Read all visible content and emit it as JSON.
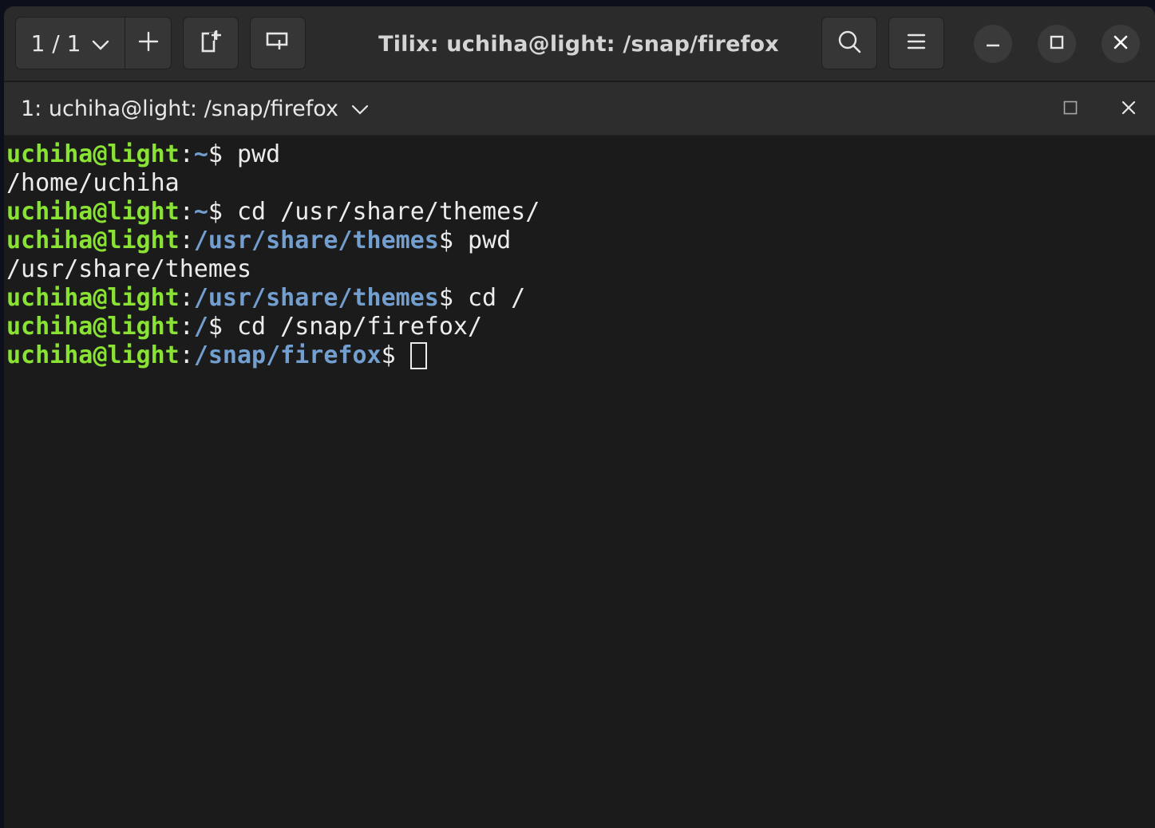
{
  "app": {
    "window_title": "Tilix: uchiha@light: /snap/firefox"
  },
  "headerbar": {
    "session_label": "1 / 1",
    "icons": {
      "session_dropdown": "chevron-down-icon",
      "add_session": "plus-icon",
      "add_terminal_right": "split-right-icon",
      "add_terminal_down": "split-down-icon",
      "search": "search-icon",
      "menu": "hamburger-icon",
      "minimize": "minimize-icon",
      "maximize": "maximize-icon",
      "close": "close-icon"
    }
  },
  "terminal_bar": {
    "title": "1: uchiha@light: /snap/firefox"
  },
  "terminal": {
    "lines": [
      {
        "type": "prompt",
        "user": "uchiha@light",
        "path": "~",
        "command": " pwd"
      },
      {
        "type": "output",
        "text": "/home/uchiha"
      },
      {
        "type": "prompt",
        "user": "uchiha@light",
        "path": "~",
        "command": " cd /usr/share/themes/"
      },
      {
        "type": "prompt",
        "user": "uchiha@light",
        "path": "/usr/share/themes",
        "command": " pwd"
      },
      {
        "type": "output",
        "text": "/usr/share/themes"
      },
      {
        "type": "prompt",
        "user": "uchiha@light",
        "path": "/usr/share/themes",
        "command": " cd /"
      },
      {
        "type": "prompt",
        "user": "uchiha@light",
        "path": "/",
        "command": " cd /snap/firefox/"
      },
      {
        "type": "prompt",
        "user": "uchiha@light",
        "path": "/snap/firefox",
        "command": "",
        "cursor": true
      }
    ]
  },
  "colors": {
    "user": "#8ae234",
    "path": "#729fcf",
    "text": "#ececec",
    "background": "#1b1b1b"
  }
}
